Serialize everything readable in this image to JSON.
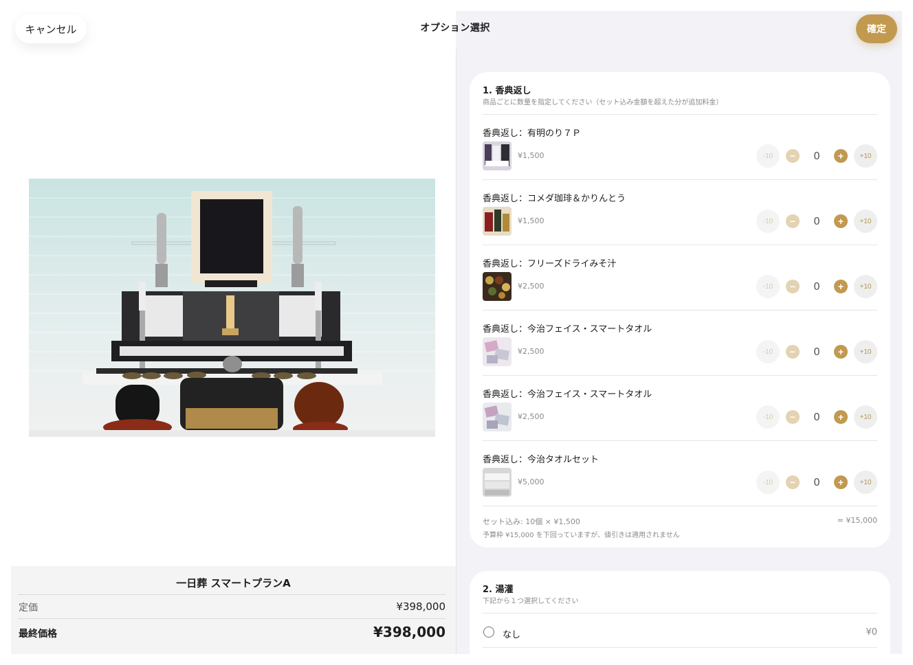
{
  "header": {
    "cancel_label": "キャンセル",
    "title": "オプション選択",
    "confirm_label": "確定"
  },
  "plan": {
    "name": "一日葬 スマートプランA",
    "list_price_label": "定価",
    "list_price": "¥398,000",
    "final_price_label": "最終価格",
    "final_price": "¥398,000"
  },
  "section1": {
    "title": "1. 香典返し",
    "subtitle": "商品ごとに数量を指定してください（セット込み金額を超えた分が追加料金）",
    "items": [
      {
        "name": "香典返し：有明のり７Ｐ",
        "price": "¥1,500",
        "qty": "0"
      },
      {
        "name": "香典返し：コメダ珈琲＆かりんとう",
        "price": "¥1,500",
        "qty": "0"
      },
      {
        "name": "香典返し：フリーズドライみそ汁",
        "price": "¥2,500",
        "qty": "0"
      },
      {
        "name": "香典返し：今治フェイス・スマートタオル",
        "price": "¥2,500",
        "qty": "0"
      },
      {
        "name": "香典返し：今治フェイス・スマートタオル",
        "price": "¥2,500",
        "qty": "0"
      },
      {
        "name": "香典返し：今治タオルセット",
        "price": "¥5,000",
        "qty": "0"
      }
    ],
    "minus10_label": "-10",
    "minus_label": "−",
    "plus_label": "+",
    "plus10_label": "+10",
    "summary_left": "セット込み: 10個 × ¥1,500",
    "summary_right": "= ¥15,000",
    "summary_note": "予算枠 ¥15,000 を下回っていますが、値引きは適用されません"
  },
  "section2": {
    "title": "2. 湯灌",
    "subtitle": "下記から１つ選択してください",
    "options": [
      {
        "label": "なし",
        "price": "¥0"
      }
    ]
  },
  "colors": {
    "accent": "#c19a50",
    "right_bg": "#f2f2f7",
    "price_panel_bg": "#f4f4f4"
  }
}
